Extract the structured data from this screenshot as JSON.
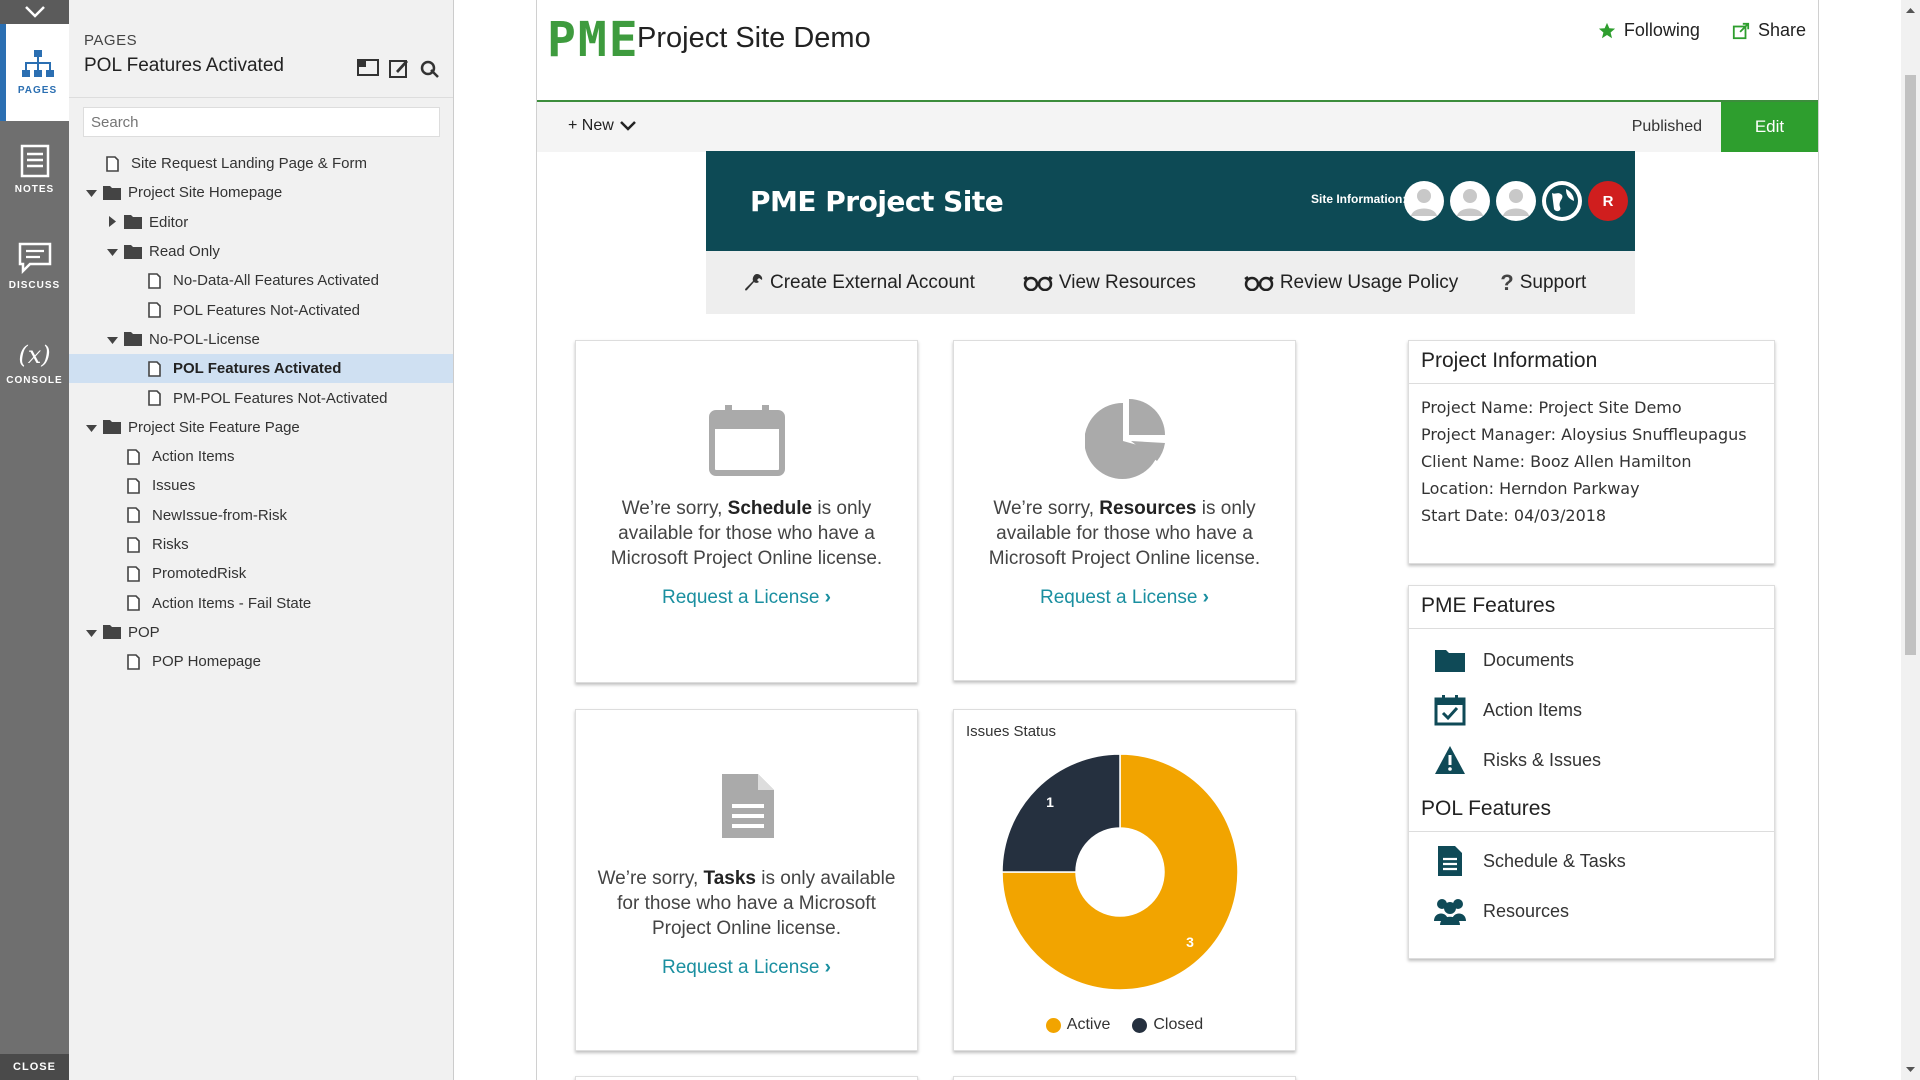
{
  "rail": {
    "items": [
      {
        "label": "PAGES",
        "icon": "sitemap-icon",
        "active": true
      },
      {
        "label": "NOTES",
        "icon": "notes-icon"
      },
      {
        "label": "DISCUSS",
        "icon": "discuss-icon"
      },
      {
        "label": "CONSOLE",
        "icon": "console-icon",
        "glyph": "(x)"
      }
    ],
    "close_label": "CLOSE"
  },
  "pages_panel": {
    "kicker": "PAGES",
    "title": "POL Features Activated",
    "search_placeholder": "Search",
    "tree": [
      {
        "label": "Site Request Landing Page & Form",
        "type": "page",
        "level": 1
      },
      {
        "label": "Project Site Homepage",
        "type": "folder",
        "level": 0,
        "expanded": true
      },
      {
        "label": "Editor",
        "type": "folder",
        "level": 1,
        "expanded": false
      },
      {
        "label": "Read Only",
        "type": "folder",
        "level": 1,
        "expanded": true
      },
      {
        "label": "No-Data-All Features Activated",
        "type": "page",
        "level": 3
      },
      {
        "label": "POL Features Not-Activated",
        "type": "page",
        "level": 3
      },
      {
        "label": "No-POL-License",
        "type": "folder",
        "level": 1,
        "expanded": true
      },
      {
        "label": "POL Features Activated",
        "type": "page",
        "level": 3,
        "selected": true
      },
      {
        "label": "PM-POL Features Not-Activated",
        "type": "page",
        "level": 3
      },
      {
        "label": "Project Site Feature Page",
        "type": "folder",
        "level": 0,
        "expanded": true
      },
      {
        "label": "Action Items",
        "type": "page",
        "level": 2
      },
      {
        "label": "Issues",
        "type": "page",
        "level": 2
      },
      {
        "label": "NewIssue-from-Risk",
        "type": "page",
        "level": 2
      },
      {
        "label": "Risks",
        "type": "page",
        "level": 2
      },
      {
        "label": "PromotedRisk",
        "type": "page",
        "level": 2
      },
      {
        "label": "Action Items - Fail State",
        "type": "page",
        "level": 2
      },
      {
        "label": "POP",
        "type": "folder",
        "level": 0,
        "expanded": true
      },
      {
        "label": "POP Homepage",
        "type": "page",
        "level": 2
      }
    ]
  },
  "header": {
    "logo": "PME",
    "site_title": "Project Site Demo",
    "following_label": "Following",
    "share_label": "Share"
  },
  "command_bar": {
    "new_label": "+ New",
    "status": "Published",
    "edit_label": "Edit"
  },
  "banner": {
    "title": "PME Project Site",
    "info_label": "Site Information:",
    "avatar_initial": "R"
  },
  "link_bar": [
    {
      "label": "Create External Account",
      "icon": "wrench-icon"
    },
    {
      "label": "View Resources",
      "icon": "glasses-icon"
    },
    {
      "label": "Review Usage Policy",
      "icon": "glasses-icon"
    },
    {
      "label": "Support",
      "icon": "question-icon"
    }
  ],
  "cards": {
    "schedule": {
      "prefix": "We’re sorry, ",
      "feature": "Schedule",
      "line1_rest": " is only",
      "line2": "available for those who have a",
      "line3": "Microsoft Project Online license.",
      "link": "Request a License"
    },
    "resources": {
      "prefix": "We’re sorry, ",
      "feature": "Resources",
      "line1_rest": " is only",
      "line2": "available for those who have a",
      "line3": "Microsoft Project Online license.",
      "link": "Request a License"
    },
    "tasks": {
      "prefix": "We’re sorry, ",
      "feature": "Tasks",
      "line1_rest": " is only available",
      "line2": "for those who have a Microsoft",
      "line3": "Project Online license.",
      "link": "Request a License"
    }
  },
  "chart_data": {
    "type": "pie",
    "title": "Issues Status",
    "donut": true,
    "series": [
      {
        "name": "Active",
        "value": 3,
        "color": "#f2a400"
      },
      {
        "name": "Closed",
        "value": 1,
        "color": "#25303f"
      }
    ],
    "legend": "bottom"
  },
  "project_info": {
    "title": "Project Information",
    "lines": [
      "Project Name: Project Site Demo",
      "Project Manager: Aloysius Snuffleupagus",
      "Client Name: Booz Allen Hamilton",
      "Location: Herndon Parkway",
      "Start Date: 04/03/2018"
    ]
  },
  "features": {
    "pme_title": "PME Features",
    "pme_items": [
      {
        "label": "Documents",
        "icon": "folder-icon"
      },
      {
        "label": "Action Items",
        "icon": "calendar-check-icon"
      },
      {
        "label": "Risks & Issues",
        "icon": "warning-icon"
      }
    ],
    "pol_title": "POL Features",
    "pol_items": [
      {
        "label": "Schedule & Tasks",
        "icon": "document-icon"
      },
      {
        "label": "Resources",
        "icon": "people-icon"
      }
    ]
  },
  "colors": {
    "brand_green": "#3e9b3e",
    "edit_green": "#2e9e2e",
    "banner_teal": "#0d4a55",
    "link_teal": "#1a8fa0",
    "selection": "#cfe0f2",
    "feature_icon": "#0f4a57"
  }
}
